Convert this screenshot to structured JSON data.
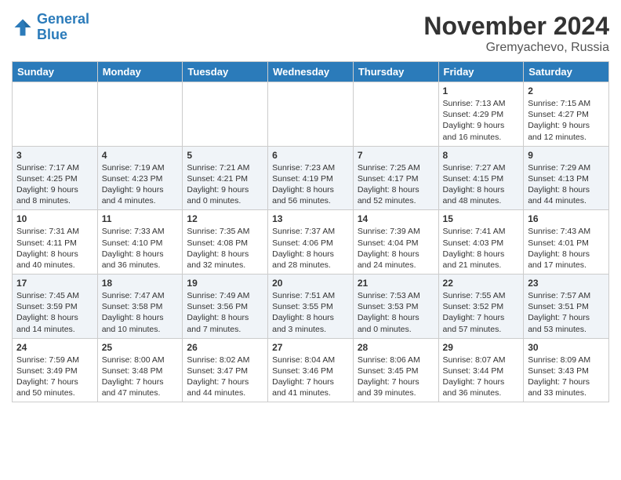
{
  "header": {
    "logo_line1": "General",
    "logo_line2": "Blue",
    "title": "November 2024",
    "location": "Gremyachevo, Russia"
  },
  "weekdays": [
    "Sunday",
    "Monday",
    "Tuesday",
    "Wednesday",
    "Thursday",
    "Friday",
    "Saturday"
  ],
  "weeks": [
    [
      {
        "day": "",
        "info": ""
      },
      {
        "day": "",
        "info": ""
      },
      {
        "day": "",
        "info": ""
      },
      {
        "day": "",
        "info": ""
      },
      {
        "day": "",
        "info": ""
      },
      {
        "day": "1",
        "info": "Sunrise: 7:13 AM\nSunset: 4:29 PM\nDaylight: 9 hours and 16 minutes."
      },
      {
        "day": "2",
        "info": "Sunrise: 7:15 AM\nSunset: 4:27 PM\nDaylight: 9 hours and 12 minutes."
      }
    ],
    [
      {
        "day": "3",
        "info": "Sunrise: 7:17 AM\nSunset: 4:25 PM\nDaylight: 9 hours and 8 minutes."
      },
      {
        "day": "4",
        "info": "Sunrise: 7:19 AM\nSunset: 4:23 PM\nDaylight: 9 hours and 4 minutes."
      },
      {
        "day": "5",
        "info": "Sunrise: 7:21 AM\nSunset: 4:21 PM\nDaylight: 9 hours and 0 minutes."
      },
      {
        "day": "6",
        "info": "Sunrise: 7:23 AM\nSunset: 4:19 PM\nDaylight: 8 hours and 56 minutes."
      },
      {
        "day": "7",
        "info": "Sunrise: 7:25 AM\nSunset: 4:17 PM\nDaylight: 8 hours and 52 minutes."
      },
      {
        "day": "8",
        "info": "Sunrise: 7:27 AM\nSunset: 4:15 PM\nDaylight: 8 hours and 48 minutes."
      },
      {
        "day": "9",
        "info": "Sunrise: 7:29 AM\nSunset: 4:13 PM\nDaylight: 8 hours and 44 minutes."
      }
    ],
    [
      {
        "day": "10",
        "info": "Sunrise: 7:31 AM\nSunset: 4:11 PM\nDaylight: 8 hours and 40 minutes."
      },
      {
        "day": "11",
        "info": "Sunrise: 7:33 AM\nSunset: 4:10 PM\nDaylight: 8 hours and 36 minutes."
      },
      {
        "day": "12",
        "info": "Sunrise: 7:35 AM\nSunset: 4:08 PM\nDaylight: 8 hours and 32 minutes."
      },
      {
        "day": "13",
        "info": "Sunrise: 7:37 AM\nSunset: 4:06 PM\nDaylight: 8 hours and 28 minutes."
      },
      {
        "day": "14",
        "info": "Sunrise: 7:39 AM\nSunset: 4:04 PM\nDaylight: 8 hours and 24 minutes."
      },
      {
        "day": "15",
        "info": "Sunrise: 7:41 AM\nSunset: 4:03 PM\nDaylight: 8 hours and 21 minutes."
      },
      {
        "day": "16",
        "info": "Sunrise: 7:43 AM\nSunset: 4:01 PM\nDaylight: 8 hours and 17 minutes."
      }
    ],
    [
      {
        "day": "17",
        "info": "Sunrise: 7:45 AM\nSunset: 3:59 PM\nDaylight: 8 hours and 14 minutes."
      },
      {
        "day": "18",
        "info": "Sunrise: 7:47 AM\nSunset: 3:58 PM\nDaylight: 8 hours and 10 minutes."
      },
      {
        "day": "19",
        "info": "Sunrise: 7:49 AM\nSunset: 3:56 PM\nDaylight: 8 hours and 7 minutes."
      },
      {
        "day": "20",
        "info": "Sunrise: 7:51 AM\nSunset: 3:55 PM\nDaylight: 8 hours and 3 minutes."
      },
      {
        "day": "21",
        "info": "Sunrise: 7:53 AM\nSunset: 3:53 PM\nDaylight: 8 hours and 0 minutes."
      },
      {
        "day": "22",
        "info": "Sunrise: 7:55 AM\nSunset: 3:52 PM\nDaylight: 7 hours and 57 minutes."
      },
      {
        "day": "23",
        "info": "Sunrise: 7:57 AM\nSunset: 3:51 PM\nDaylight: 7 hours and 53 minutes."
      }
    ],
    [
      {
        "day": "24",
        "info": "Sunrise: 7:59 AM\nSunset: 3:49 PM\nDaylight: 7 hours and 50 minutes."
      },
      {
        "day": "25",
        "info": "Sunrise: 8:00 AM\nSunset: 3:48 PM\nDaylight: 7 hours and 47 minutes."
      },
      {
        "day": "26",
        "info": "Sunrise: 8:02 AM\nSunset: 3:47 PM\nDaylight: 7 hours and 44 minutes."
      },
      {
        "day": "27",
        "info": "Sunrise: 8:04 AM\nSunset: 3:46 PM\nDaylight: 7 hours and 41 minutes."
      },
      {
        "day": "28",
        "info": "Sunrise: 8:06 AM\nSunset: 3:45 PM\nDaylight: 7 hours and 39 minutes."
      },
      {
        "day": "29",
        "info": "Sunrise: 8:07 AM\nSunset: 3:44 PM\nDaylight: 7 hours and 36 minutes."
      },
      {
        "day": "30",
        "info": "Sunrise: 8:09 AM\nSunset: 3:43 PM\nDaylight: 7 hours and 33 minutes."
      }
    ]
  ]
}
